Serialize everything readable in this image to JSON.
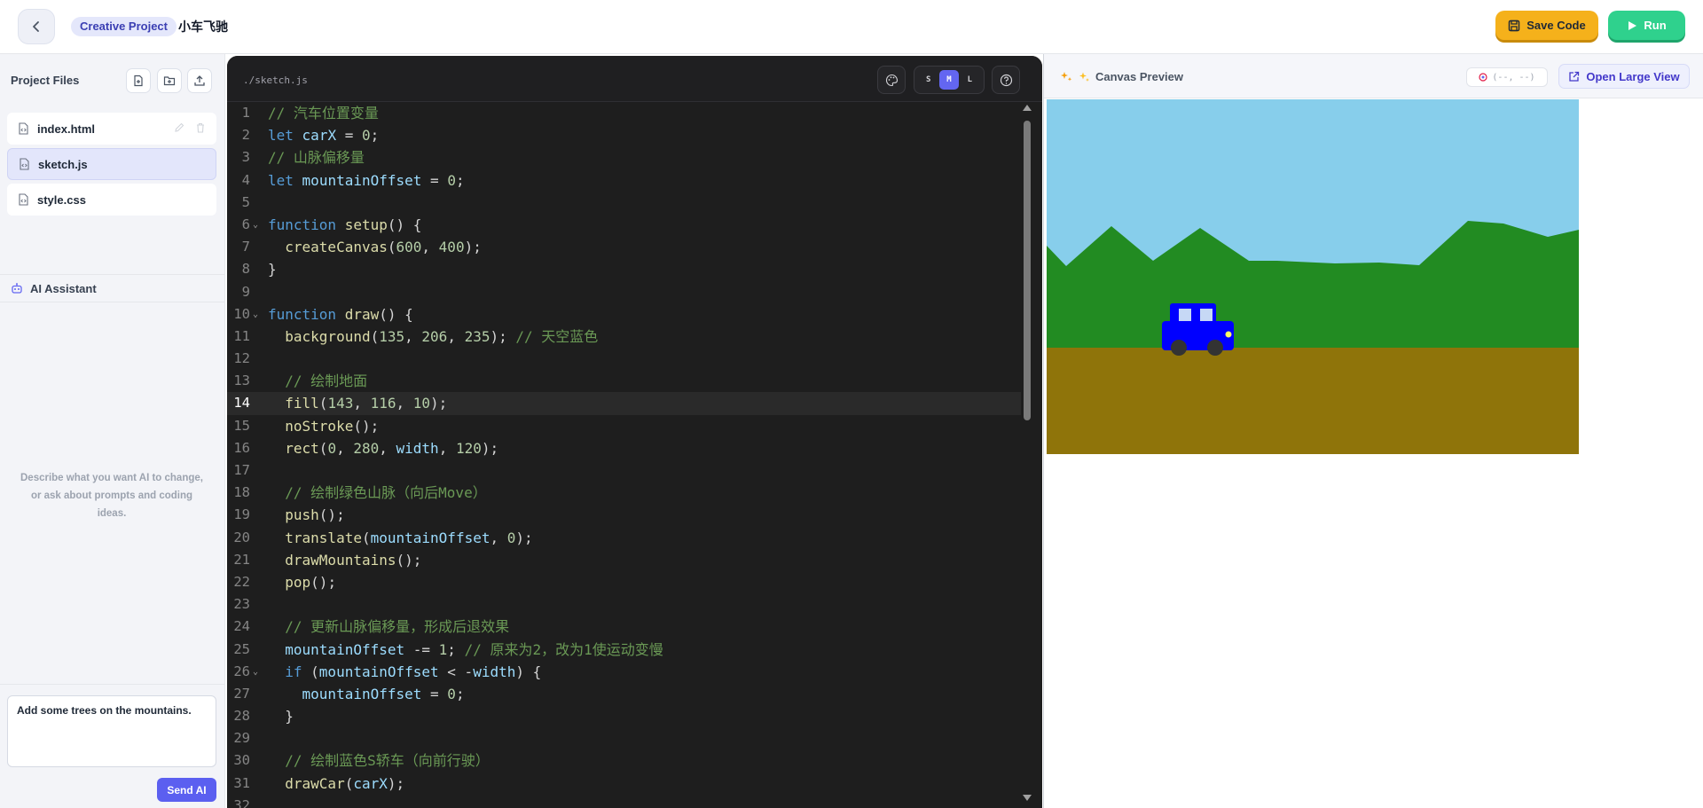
{
  "header": {
    "badge": "Creative Project",
    "title": "小车飞驰",
    "save_label": "Save Code",
    "run_label": "Run"
  },
  "sidebar": {
    "files_title": "Project Files",
    "files": [
      {
        "name": "index.html",
        "active": false
      },
      {
        "name": "sketch.js",
        "active": true
      },
      {
        "name": "style.css",
        "active": false
      }
    ],
    "ai_title": "AI Assistant",
    "ai_hint": "Describe what you want AI to change, or ask about prompts and coding ideas.",
    "ai_input_value": "Add some trees on the mountains.",
    "send_label": "Send AI"
  },
  "editor": {
    "path": "./sketch.js",
    "sizes": [
      "S",
      "M",
      "L"
    ],
    "active_size": "M",
    "current_line": 14,
    "lines": [
      "// 汽车位置变量",
      "let carX = 0;",
      "// 山脉偏移量",
      "let mountainOffset = 0;",
      "",
      "function setup() {",
      "  createCanvas(600, 400);",
      "}",
      "",
      "function draw() {",
      "  background(135, 206, 235); // 天空蓝色",
      "",
      "  // 绘制地面",
      "  fill(143, 116, 10);",
      "  noStroke();",
      "  rect(0, 280, width, 120);",
      "",
      "  // 绘制绿色山脉（向后Move）",
      "  push();",
      "  translate(mountainOffset, 0);",
      "  drawMountains();",
      "  pop();",
      "",
      "  // 更新山脉偏移量，形成后退效果",
      "  mountainOffset -= 1; // 原来为2，改为1使运动变慢",
      "  if (mountainOffset < -width) {",
      "    mountainOffset = 0;",
      "  }",
      "",
      "  // 绘制蓝色S轿车（向前行驶）",
      "  drawCar(carX);",
      ""
    ],
    "fold_lines": [
      6,
      10,
      26
    ]
  },
  "preview": {
    "title": "Canvas Preview",
    "coords": "(--, --)",
    "open_label": "Open Large View"
  },
  "colors": {
    "accent": "#5b5ff0",
    "save": "#f5b11b",
    "run": "#2fd18d",
    "sky": "#87ceeb",
    "ground": "#8f740a",
    "mountain": "#228b22",
    "car": "#0000ff"
  },
  "icons": {
    "back": "chevron-left-icon",
    "save": "floppy-disk-icon",
    "run": "play-icon",
    "new_file": "new-file-icon",
    "new_folder": "new-folder-icon",
    "upload": "upload-icon",
    "file": "code-file-icon",
    "ai": "robot-icon",
    "palette": "palette-icon",
    "help": "help-circle-icon",
    "preview": "sparkles-icon",
    "open": "external-link-icon"
  }
}
